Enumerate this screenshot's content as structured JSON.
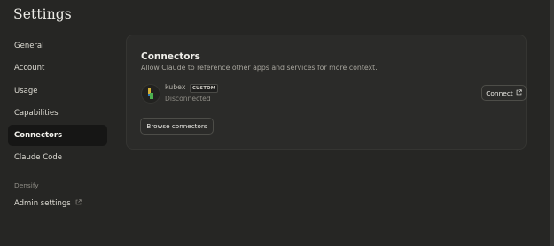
{
  "header": {
    "title": "Settings"
  },
  "sidebar": {
    "items": [
      {
        "label": "General"
      },
      {
        "label": "Account"
      },
      {
        "label": "Usage"
      },
      {
        "label": "Capabilities"
      },
      {
        "label": "Connectors",
        "active": true
      },
      {
        "label": "Claude Code"
      }
    ],
    "section_label": "Densify",
    "admin_label": "Admin settings"
  },
  "connectors": {
    "title": "Connectors",
    "subtitle": "Allow Claude to reference other apps and services for more context.",
    "items": [
      {
        "name": "kubex",
        "badge": "CUSTOM",
        "status": "Disconnected",
        "action_label": "Connect",
        "icon": "kubex-logo"
      }
    ],
    "browse_label": "Browse connectors"
  },
  "colors": {
    "background": "#262624",
    "card": "#2b2b29",
    "active_nav": "#161615",
    "logo_yellow": "#d4b23a",
    "logo_green": "#4caf50"
  }
}
